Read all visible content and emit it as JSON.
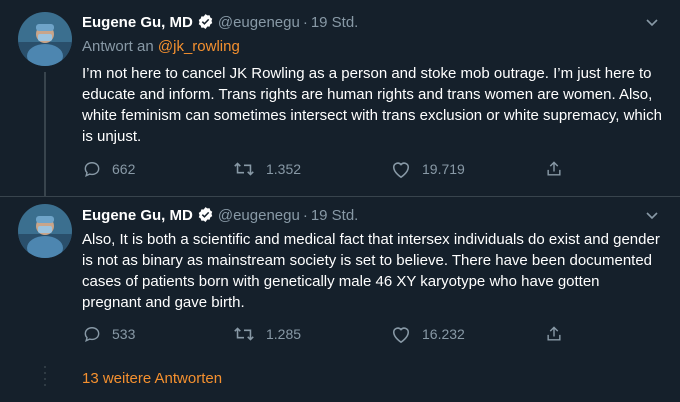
{
  "tweets": [
    {
      "display_name": "Eugene Gu, MD",
      "handle": "@eugenegu",
      "separator": "·",
      "time": "19 Std.",
      "reply_prefix": "Antwort an",
      "reply_mention": "@jk_rowling",
      "text": "I’m not here to cancel JK Rowling as a person and stoke mob outrage. I’m just here to educate and inform. Trans rights are human rights and trans women are women. Also, white feminism can sometimes intersect with trans exclusion or white supremacy, which is unjust.",
      "replies": "662",
      "retweets": "1.352",
      "likes": "19.719"
    },
    {
      "display_name": "Eugene Gu, MD",
      "handle": "@eugenegu",
      "separator": "·",
      "time": "19 Std.",
      "text": "Also, It is both a scientific and medical fact that intersex individuals do exist and gender is not as binary as mainstream society is set to believe. There have been documented cases of patients born with genetically male 46 XY karyotype who have gotten pregnant and gave birth.",
      "replies": "533",
      "retweets": "1.285",
      "likes": "16.232"
    }
  ],
  "more_replies": "13 weitere Antworten",
  "colors": {
    "background": "#15202b",
    "muted": "#8899a6",
    "accent": "#f4902f",
    "divider": "#38444d"
  },
  "icons": [
    "verified-badge-icon",
    "chevron-down-icon",
    "reply-icon",
    "retweet-icon",
    "like-icon",
    "share-icon"
  ]
}
